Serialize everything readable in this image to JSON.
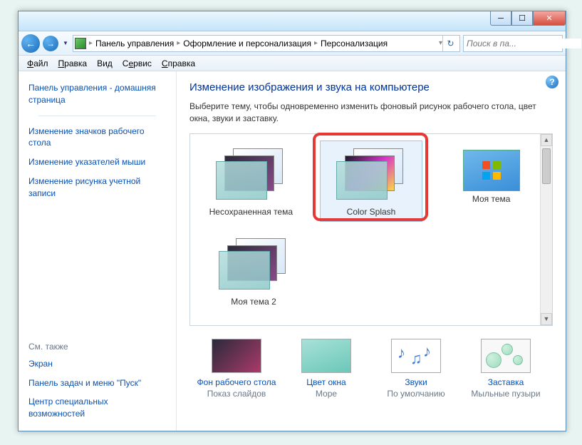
{
  "breadcrumb": {
    "items": [
      "Панель управления",
      "Оформление и персонализация",
      "Персонализация"
    ]
  },
  "search": {
    "placeholder": "Поиск в па..."
  },
  "menu": {
    "file": "Файл",
    "edit": "Правка",
    "view": "Вид",
    "tools": "Сервис",
    "help": "Справка"
  },
  "sidebar": {
    "home": "Панель управления - домашняя страница",
    "links": [
      "Изменение значков рабочего стола",
      "Изменение указателей мыши",
      "Изменение рисунка учетной записи"
    ],
    "see_also_heading": "См. также",
    "see_also": [
      "Экран",
      "Панель задач и меню \"Пуск\"",
      "Центр специальных возможностей"
    ]
  },
  "main": {
    "title": "Изменение изображения и звука на компьютере",
    "desc": "Выберите тему, чтобы одновременно изменить фоновый рисунок рабочего стола, цвет окна, звуки и заставку."
  },
  "themes": [
    {
      "label": "Несохраненная тема"
    },
    {
      "label": "Color Splash"
    },
    {
      "label": "Моя тема"
    },
    {
      "label": "Моя тема 2"
    }
  ],
  "footer": {
    "desktop": {
      "link": "Фон рабочего стола",
      "sub": "Показ слайдов"
    },
    "color": {
      "link": "Цвет окна",
      "sub": "Море"
    },
    "sound": {
      "link": "Звуки",
      "sub": "По умолчанию"
    },
    "saver": {
      "link": "Заставка",
      "sub": "Мыльные пузыри"
    }
  }
}
